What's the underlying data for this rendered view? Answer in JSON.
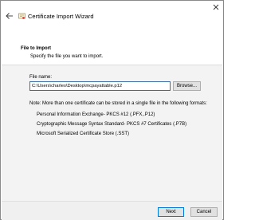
{
  "window": {
    "title": "Certificate Import Wizard"
  },
  "header": {
    "section_title": "File to Import",
    "subtitle": "Specify the file you want to import."
  },
  "file": {
    "label": "File name:",
    "value": "C:\\Users\\charles\\Desktop\\mcpayattable.p12",
    "browse_label": "Browse..."
  },
  "note": {
    "text": "Note: More than one certificate can be stored in a single file in the following formats:",
    "formats": [
      "Personal Information Exchange- PKCS #12 (.PFX,.P12)",
      "Cryptographic Message Syntax Standard- PKCS #7 Certificates (.P7B)",
      "Microsoft Serialized Certificate Store (.SST)"
    ]
  },
  "footer": {
    "next_label": "Next",
    "cancel_label": "Cancel"
  },
  "colors": {
    "accent": "#0078d7",
    "content_bg": "#f3f3f3"
  }
}
